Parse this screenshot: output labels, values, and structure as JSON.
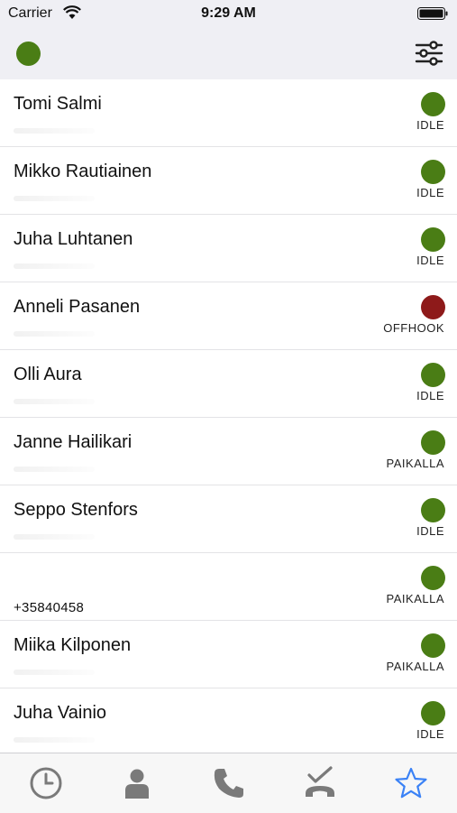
{
  "status_bar": {
    "carrier": "Carrier",
    "time": "9:29 AM"
  },
  "header": {
    "own_status_color": "#4a7d15",
    "filter_icon": "sliders-icon"
  },
  "colors": {
    "green": "#4a7d15",
    "red": "#8e1a1a",
    "tab_inactive": "#7a7a7a",
    "tab_active": "#3b82f6"
  },
  "contacts": [
    {
      "name": "Tomi Salmi",
      "number": "",
      "state": "IDLE",
      "status_color": "#4a7d15"
    },
    {
      "name": "Mikko Rautiainen",
      "number": "",
      "state": "IDLE",
      "status_color": "#4a7d15"
    },
    {
      "name": "Juha Luhtanen",
      "number": "",
      "state": "IDLE",
      "status_color": "#4a7d15"
    },
    {
      "name": "Anneli Pasanen",
      "number": "",
      "state": "OFFHOOK",
      "status_color": "#8e1a1a"
    },
    {
      "name": "Olli Aura",
      "number": "",
      "state": "IDLE",
      "status_color": "#4a7d15"
    },
    {
      "name": "Janne Hailikari",
      "number": "",
      "state": "PAIKALLA",
      "status_color": "#4a7d15"
    },
    {
      "name": "Seppo Stenfors",
      "number": "",
      "state": "IDLE",
      "status_color": "#4a7d15"
    },
    {
      "name": "",
      "number": "+35840458",
      "state": "PAIKALLA",
      "status_color": "#4a7d15"
    },
    {
      "name": "Miika Kilponen",
      "number": "",
      "state": "PAIKALLA",
      "status_color": "#4a7d15"
    },
    {
      "name": "Juha Vainio",
      "number": "",
      "state": "IDLE",
      "status_color": "#4a7d15"
    }
  ],
  "tabs": [
    {
      "icon": "clock-icon",
      "active": false
    },
    {
      "icon": "contact-icon",
      "active": false
    },
    {
      "icon": "phone-icon",
      "active": false
    },
    {
      "icon": "callback-icon",
      "active": false
    },
    {
      "icon": "star-icon",
      "active": true
    }
  ]
}
